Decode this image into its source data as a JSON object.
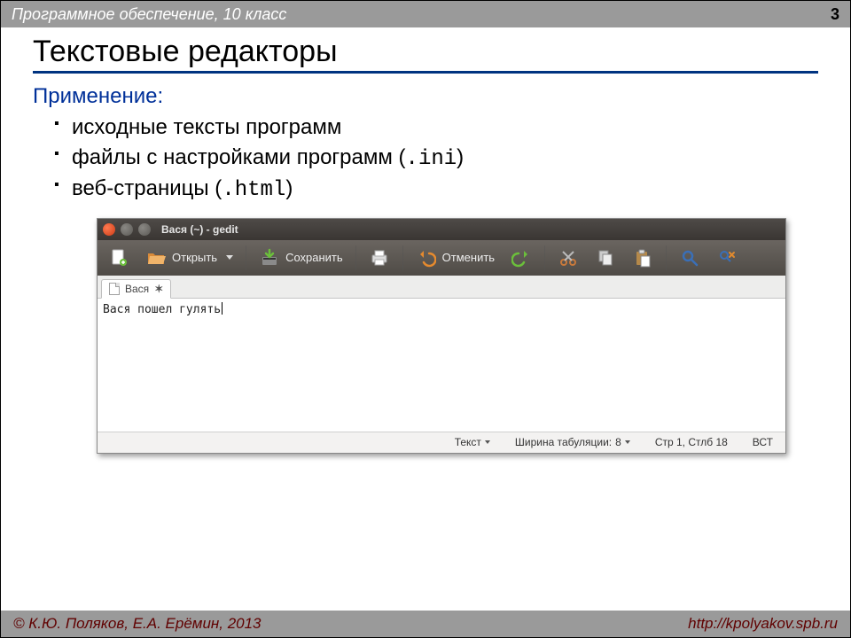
{
  "header": {
    "course": "Программное обеспечение, 10 класс",
    "page": "3"
  },
  "title": "Текстовые редакторы",
  "application_label": "Применение:",
  "bullets": [
    {
      "text": "исходные тексты программ"
    },
    {
      "pre": "файлы с настройками программ (",
      "code": ".ini",
      "post": ")"
    },
    {
      "pre": "веб-страницы (",
      "code": ".html",
      "post": ")"
    }
  ],
  "gedit": {
    "window_title": "Вася (~) - gedit",
    "toolbar": {
      "open": "Открыть",
      "save": "Сохранить",
      "undo": "Отменить"
    },
    "tab": {
      "name": "Вася",
      "close": "✶"
    },
    "text": "Вася пошел гулять",
    "status": {
      "mode": "Текст",
      "tabwidth_label": "Ширина табуляции:",
      "tabwidth_value": "8",
      "position": "Стр 1, Стлб 18",
      "insert": "ВСТ"
    }
  },
  "footer": {
    "left": "© К.Ю. Поляков, Е.А. Ерёмин, 2013",
    "right": "http://kpolyakov.spb.ru"
  }
}
